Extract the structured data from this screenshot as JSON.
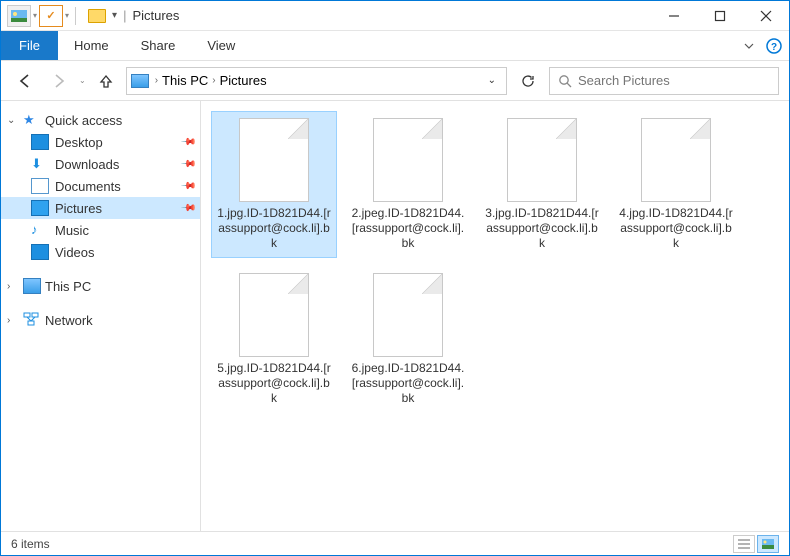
{
  "window": {
    "title": "Pictures"
  },
  "ribbon": {
    "file": "File",
    "tabs": [
      "Home",
      "Share",
      "View"
    ]
  },
  "breadcrumb": {
    "root": "This PC",
    "current": "Pictures"
  },
  "search": {
    "placeholder": "Search Pictures"
  },
  "sidebar": {
    "quick_access": "Quick access",
    "items": [
      {
        "label": "Desktop",
        "pinned": true
      },
      {
        "label": "Downloads",
        "pinned": true
      },
      {
        "label": "Documents",
        "pinned": true
      },
      {
        "label": "Pictures",
        "pinned": true,
        "selected": true
      },
      {
        "label": "Music",
        "pinned": false
      },
      {
        "label": "Videos",
        "pinned": false
      }
    ],
    "this_pc": "This PC",
    "network": "Network"
  },
  "files": [
    {
      "name": "1.jpg.ID-1D821D44.[rassupport@cock.li].bk",
      "selected": true
    },
    {
      "name": "2.jpeg.ID-1D821D44.[rassupport@cock.li].bk",
      "selected": false
    },
    {
      "name": "3.jpg.ID-1D821D44.[rassupport@cock.li].bk",
      "selected": false
    },
    {
      "name": "4.jpg.ID-1D821D44.[rassupport@cock.li].bk",
      "selected": false
    },
    {
      "name": "5.jpg.ID-1D821D44.[rassupport@cock.li].bk",
      "selected": false
    },
    {
      "name": "6.jpeg.ID-1D821D44.[rassupport@cock.li].bk",
      "selected": false
    }
  ],
  "status": {
    "count_text": "6 items"
  }
}
